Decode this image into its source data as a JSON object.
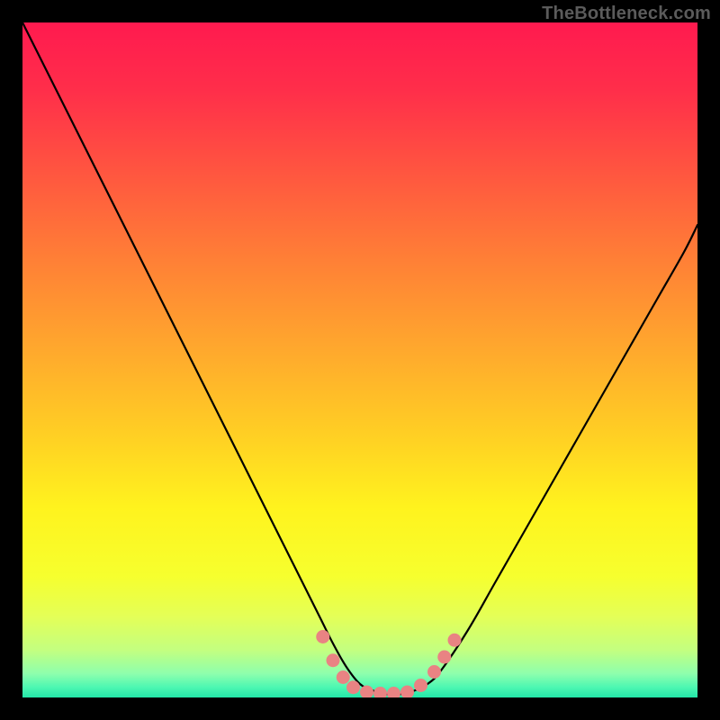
{
  "watermark": {
    "text": "TheBottleneck.com"
  },
  "gradient": {
    "stops": [
      {
        "offset": 0.0,
        "color": "#ff1a4f"
      },
      {
        "offset": 0.1,
        "color": "#ff2e4a"
      },
      {
        "offset": 0.22,
        "color": "#ff5540"
      },
      {
        "offset": 0.35,
        "color": "#ff7f36"
      },
      {
        "offset": 0.5,
        "color": "#ffad2c"
      },
      {
        "offset": 0.62,
        "color": "#ffd223"
      },
      {
        "offset": 0.72,
        "color": "#fff31e"
      },
      {
        "offset": 0.82,
        "color": "#f6ff2e"
      },
      {
        "offset": 0.88,
        "color": "#e4ff57"
      },
      {
        "offset": 0.93,
        "color": "#c3ff80"
      },
      {
        "offset": 0.965,
        "color": "#8dffad"
      },
      {
        "offset": 0.985,
        "color": "#4cf7b2"
      },
      {
        "offset": 1.0,
        "color": "#23e6a8"
      }
    ]
  },
  "chart_data": {
    "type": "line",
    "title": "",
    "xlabel": "",
    "ylabel": "",
    "xlim": [
      0,
      100
    ],
    "ylim": [
      0,
      100
    ],
    "series": [
      {
        "name": "bottleneck-curve",
        "x": [
          0,
          4,
          8,
          12,
          16,
          20,
          24,
          28,
          32,
          36,
          40,
          44,
          46,
          48,
          50,
          52,
          54,
          56,
          58,
          60,
          62,
          66,
          70,
          74,
          78,
          82,
          86,
          90,
          94,
          98,
          100
        ],
        "y": [
          100,
          92,
          84,
          76,
          68,
          60,
          52,
          44,
          36,
          28,
          20,
          12,
          8,
          4.5,
          2,
          1,
          0.5,
          0.5,
          1,
          2,
          4,
          10,
          17,
          24,
          31,
          38,
          45,
          52,
          59,
          66,
          70
        ]
      }
    ],
    "markers": {
      "name": "highlight-dots",
      "color": "#e98383",
      "points": [
        {
          "x": 44.5,
          "y": 9.0
        },
        {
          "x": 46.0,
          "y": 5.5
        },
        {
          "x": 47.5,
          "y": 3.0
        },
        {
          "x": 49.0,
          "y": 1.5
        },
        {
          "x": 51.0,
          "y": 0.8
        },
        {
          "x": 53.0,
          "y": 0.6
        },
        {
          "x": 55.0,
          "y": 0.6
        },
        {
          "x": 57.0,
          "y": 0.8
        },
        {
          "x": 59.0,
          "y": 1.8
        },
        {
          "x": 61.0,
          "y": 3.8
        },
        {
          "x": 62.5,
          "y": 6.0
        },
        {
          "x": 64.0,
          "y": 8.5
        }
      ]
    }
  }
}
